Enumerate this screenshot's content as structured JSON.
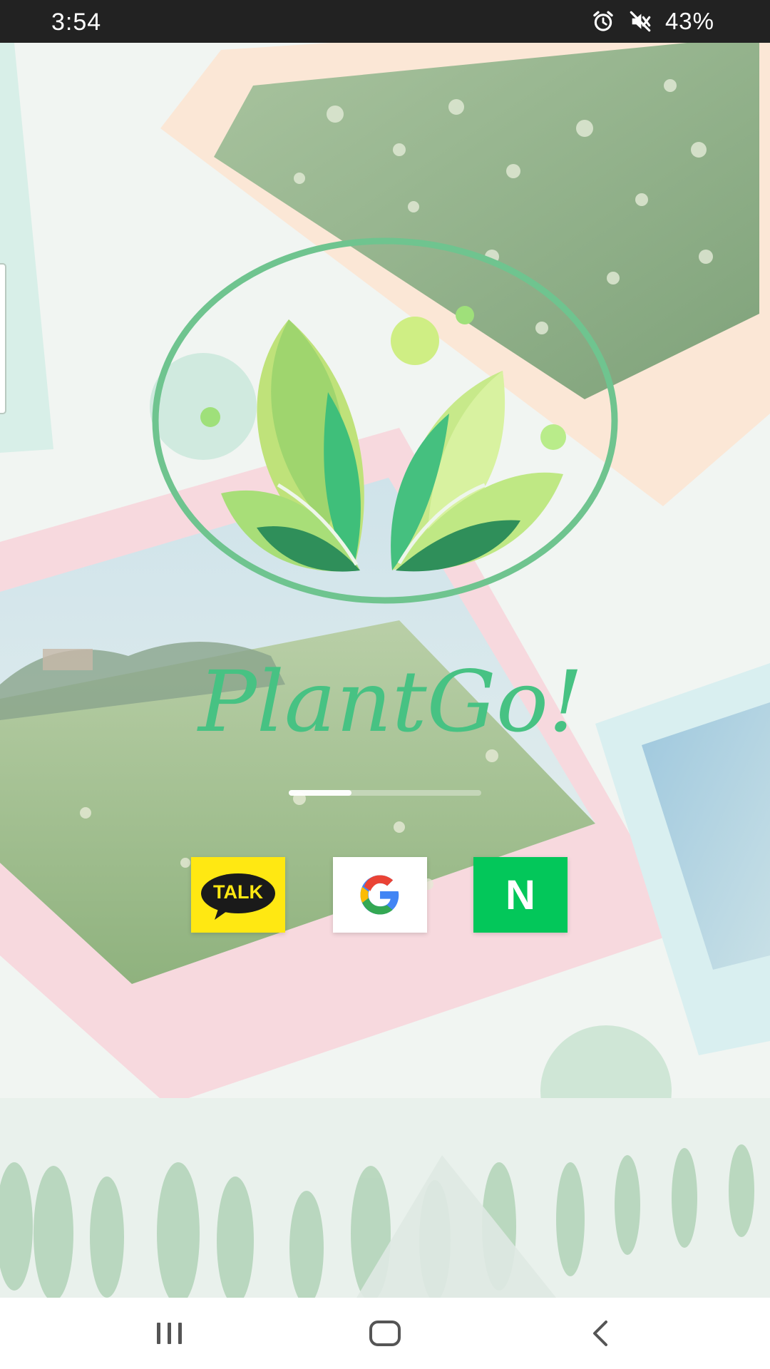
{
  "status_bar": {
    "time": "3:54",
    "battery": "43%",
    "icons": [
      "alarm-icon",
      "mute-icon"
    ]
  },
  "app": {
    "wordmark": "PlantGo!"
  },
  "carousel": {
    "active_index": 1,
    "total": 3
  },
  "login": {
    "kakao_label": "TALK",
    "naver_label": "N",
    "google_icon": "google-g-icon"
  },
  "nav_bar": {
    "icons": [
      "recents-icon",
      "home-icon",
      "back-icon"
    ]
  },
  "colors": {
    "brand_green": "#4DBF82",
    "kakao_yellow": "#FFE812",
    "naver_green": "#03C75A",
    "status_bar": "#222222"
  }
}
